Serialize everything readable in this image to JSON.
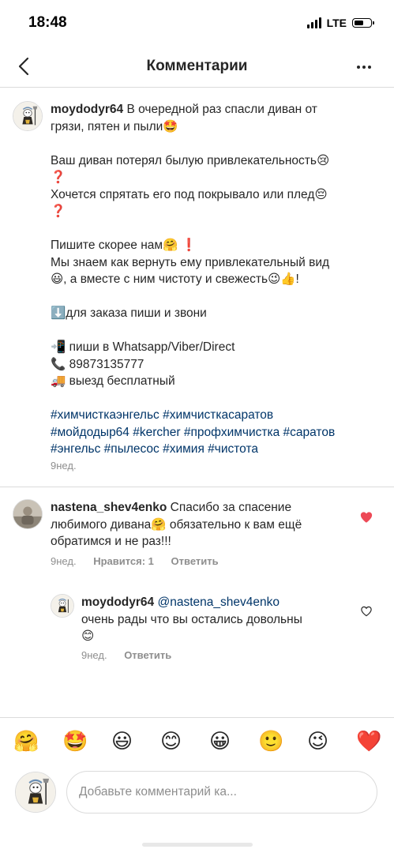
{
  "status_bar": {
    "time": "18:48",
    "network": "LTE"
  },
  "header": {
    "title": "Комментарии"
  },
  "post": {
    "username": "moydodyr64",
    "first_line": "В очередной раз спасли диван от",
    "lines": [
      "грязи, пятен и пыли🤩",
      "",
      "Ваш диван потерял былую привлекательность😢",
      "❓",
      "Хочется спрятать его под покрывало или плед😔",
      "❓",
      "",
      "Пишите скорее нам🤗 ❗",
      "Мы знаем как вернуть ему привлекательный вид",
      "😃, а вместе с ним чистоту и свежесть😉👍!",
      "",
      "⬇️для заказа пиши и звони",
      "",
      "📲 пиши в Whatsapp/Viber/Direct",
      "📞 89873135777",
      "🚚 выезд бесплатный",
      ""
    ],
    "hashtags": [
      "#химчисткаэнгельс #химчисткасаратов",
      "#мойдодыр64 #kercher #профхимчистка #саратов",
      "#энгельс #пылесос #химия #чистота"
    ],
    "time": "9нед."
  },
  "comments": [
    {
      "username": "nastena_shev4enko",
      "first_line": "Спасибо за спасение",
      "lines": [
        "любимого дивана🤗 обязательно к вам ещё",
        "обратимся и не раз!!!"
      ],
      "time": "9нед.",
      "likes": "Нравится: 1",
      "reply_label": "Ответить",
      "liked": true,
      "reply": {
        "username": "moydodyr64",
        "mention": "@nastena_shev4enko",
        "lines": [
          "очень рады что вы остались довольны",
          "😊"
        ],
        "time": "9нед.",
        "reply_label": "Ответить",
        "liked": false
      }
    }
  ],
  "emoji_bar": [
    "🤗",
    "🤩",
    "😃",
    "😊",
    "😀",
    "🙂",
    "😉",
    "❤️"
  ],
  "composer": {
    "placeholder": "Добавьте комментарий ка..."
  },
  "colors": {
    "like_red": "#ed4956",
    "link_blue": "#003569",
    "meta_gray": "#8e8e8e",
    "divider": "#dbdbdb"
  }
}
